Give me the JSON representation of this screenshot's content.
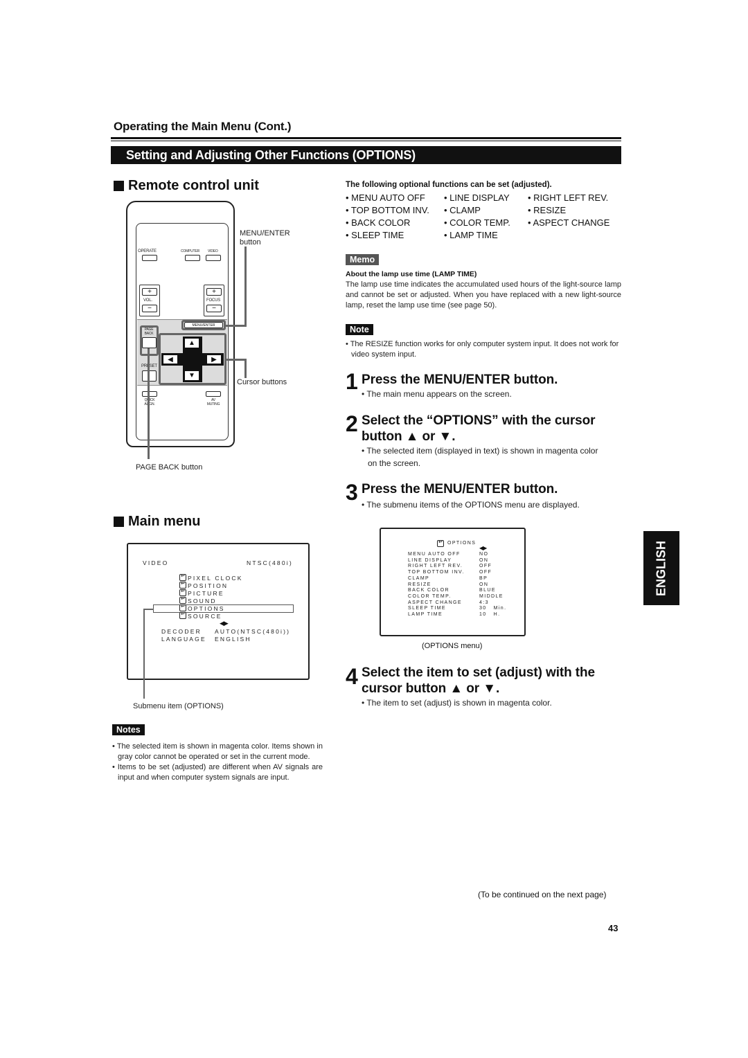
{
  "header": {
    "section": "Operating the Main Menu (Cont.)",
    "title": "Setting and Adjusting Other Functions (OPTIONS)"
  },
  "remote": {
    "heading": "Remote control unit",
    "labels": {
      "operate": "OPERATE",
      "computer": "COMPUTER",
      "video": "VIDEO",
      "vol": "VOL.",
      "focus": "FOCUS",
      "plus": "+",
      "minus": "−",
      "menu_enter": "MENU/ENTER",
      "page_back": "PAGE BACK",
      "preset": "PRESET",
      "quick_align": "QUICK ALIGN.",
      "av_muting": "AV MUTING",
      "up": "▲",
      "down": "▼",
      "left": "◀",
      "right": "▶"
    },
    "callouts": {
      "menu_enter_line1": "MENU/ENTER",
      "menu_enter_line2": "button",
      "cursor": "Cursor buttons",
      "page_back": "PAGE BACK button"
    }
  },
  "functions": {
    "title": "The following optional functions can be set (adjusted).",
    "items": [
      "• MENU AUTO OFF",
      "• LINE DISPLAY",
      "• RIGHT LEFT REV.",
      "• TOP BOTTOM INV.",
      "• CLAMP",
      "• RESIZE",
      "• BACK COLOR",
      "• COLOR TEMP.",
      "• ASPECT CHANGE",
      "• SLEEP TIME",
      "• LAMP TIME"
    ]
  },
  "memo": {
    "badge": "Memo",
    "subtitle": "About the lamp use time (LAMP TIME)",
    "text": "The lamp use time indicates the accumulated used hours of the light-source lamp and cannot be set or adjusted. When you have replaced with a new light-source lamp, reset the lamp use time (see page 50)."
  },
  "note": {
    "badge": "Note",
    "text": "• The RESIZE function works for only computer system input. It does not work for video system input."
  },
  "steps": [
    {
      "num": "1",
      "title": "Press the MENU/ENTER button.",
      "note": "• The main menu appears on the screen."
    },
    {
      "num": "2",
      "title_line1": "Select the “OPTIONS” with the cursor",
      "title_line2": "button ▲ or ▼.",
      "note_line1": "• The selected item (displayed in text) is shown in magenta color",
      "note_line2": "on the screen."
    },
    {
      "num": "3",
      "title": "Press the MENU/ENTER button.",
      "note": "• The submenu items of the OPTIONS menu are displayed."
    },
    {
      "num": "4",
      "title_line1": "Select the item to set (adjust) with the",
      "title_line2": "cursor button ▲ or ▼.",
      "note": "• The item to set (adjust) is shown in magenta color."
    }
  ],
  "main_menu": {
    "heading": "Main menu",
    "source": "VIDEO",
    "signal": "NTSC(480i)",
    "items": [
      "PIXEL CLOCK",
      "POSITION",
      "PICTURE",
      "SOUND",
      "OPTIONS",
      "SOURCE"
    ],
    "selected": "OPTIONS",
    "lr_arrows": "◀▶",
    "settings": [
      {
        "label": "DECODER",
        "value": "AUTO(NTSC(480i))"
      },
      {
        "label": "LANGUAGE",
        "value": "ENGLISH"
      }
    ],
    "callout": "Submenu item (OPTIONS)"
  },
  "notes": {
    "badge": "Notes",
    "items": [
      "• The selected item is shown in magenta color. Items shown in gray color cannot be operated or set in the current mode.",
      "• Items to be set (adjusted) are different when AV signals are input and when computer system signals are input."
    ]
  },
  "options_menu": {
    "title": "OPTIONS",
    "lr_arrows": "◀▶",
    "rows": [
      {
        "label": "MENU AUTO OFF",
        "value": "NO"
      },
      {
        "label": "LINE DISPLAY",
        "value": "ON"
      },
      {
        "label": "RIGHT LEFT REV.",
        "value": "OFF"
      },
      {
        "label": "TOP BOTTOM INV.",
        "value": "OFF"
      },
      {
        "label": "CLAMP",
        "value": "BP"
      },
      {
        "label": "RESIZE",
        "value": "ON"
      },
      {
        "label": "BACK COLOR",
        "value": "BLUE"
      },
      {
        "label": "COLOR TEMP.",
        "value": "MIDDLE"
      },
      {
        "label": "ASPECT CHANGE",
        "value": "4:3"
      },
      {
        "label": "SLEEP TIME",
        "value": "30   Min."
      },
      {
        "label": "LAMP TIME",
        "value": "10   H."
      }
    ],
    "caption": "(OPTIONS menu)"
  },
  "side_tab": "ENGLISH",
  "footer": {
    "continued": "(To be continued on the next page)",
    "page_number": "43"
  }
}
